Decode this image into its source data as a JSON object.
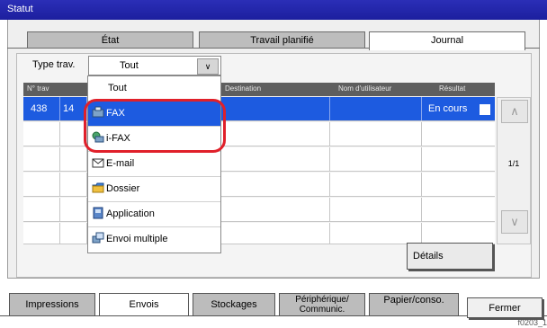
{
  "window": {
    "title": "Statut"
  },
  "tabs": [
    {
      "label": "État",
      "active": false
    },
    {
      "label": "Travail planifié",
      "active": false
    },
    {
      "label": "Journal",
      "active": true
    }
  ],
  "job_type": {
    "label": "Type trav.",
    "value": "Tout"
  },
  "table": {
    "headers": [
      "N° trav",
      "Destination",
      "Nom d'utilisateur",
      "Résultat"
    ],
    "rows": [
      {
        "job_no": "438",
        "date_fragment": "14",
        "result": "En cours",
        "selected": true
      }
    ]
  },
  "dropdown": {
    "items": [
      {
        "label": "Tout",
        "icon": "none"
      },
      {
        "label": "FAX",
        "icon": "fax-icon"
      },
      {
        "label": "i-FAX",
        "icon": "ifax-icon"
      },
      {
        "label": "E-mail",
        "icon": "email-icon"
      },
      {
        "label": "Dossier",
        "icon": "folder-icon"
      },
      {
        "label": "Application",
        "icon": "application-icon"
      },
      {
        "label": "Envoi multiple",
        "icon": "multi-send-icon"
      }
    ]
  },
  "pager": "1/1",
  "details_button": "Détails",
  "bottom_tabs": [
    {
      "label": "Impressions",
      "active": false
    },
    {
      "label": "Envois",
      "active": true
    },
    {
      "label": "Stockages",
      "active": false
    },
    {
      "label": "Périphérique/ Communic.",
      "active": false
    },
    {
      "label": "Papier/conso.",
      "active": false
    }
  ],
  "close_button": "Fermer",
  "figure_id": "f0203_1",
  "colors": {
    "title_bar": "#1c1f9e",
    "selection": "#1d5be0",
    "highlight": "#e0202a"
  }
}
